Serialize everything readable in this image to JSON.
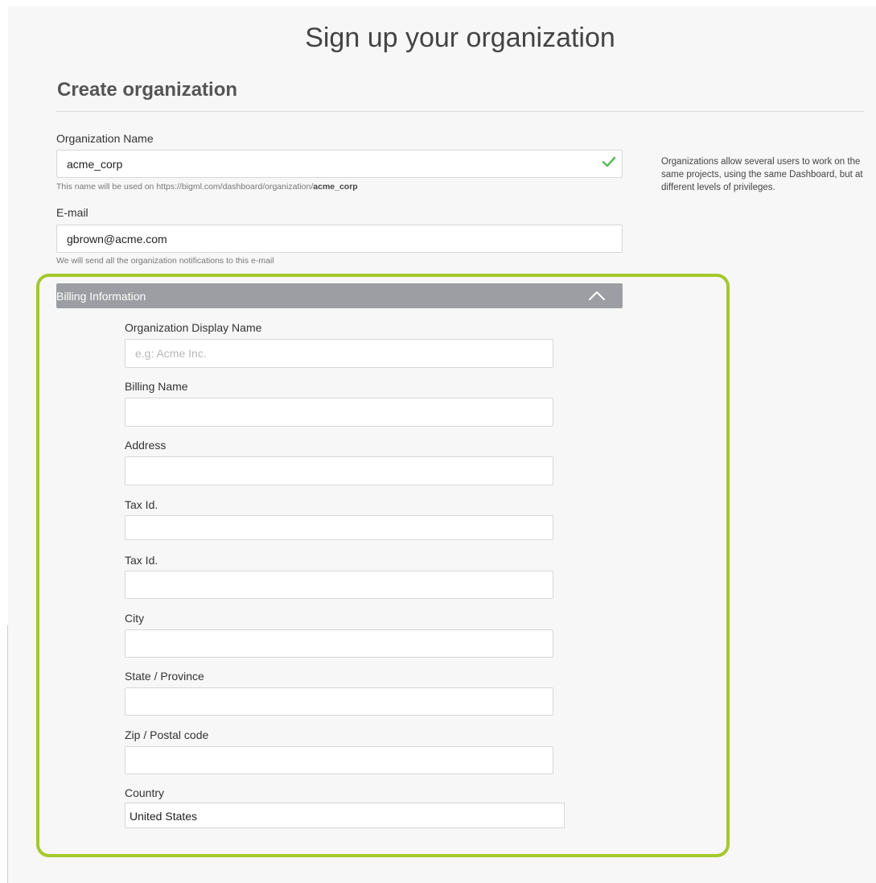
{
  "page": {
    "title": "Sign up your organization"
  },
  "section": {
    "title": "Create organization"
  },
  "org_name": {
    "label": "Organization Name",
    "value": "acme_corp",
    "hint_prefix": "This name will be used on https://bigml.com/dashboard/organization/",
    "hint_slug": "acme_corp",
    "valid_icon": "check-icon"
  },
  "email": {
    "label": "E-mail",
    "value": "gbrown@acme.com",
    "hint": "We will send all the organization notifications to this e-mail"
  },
  "side_note": "Organizations allow several users to work on the same projects, using the same Dashboard, but at different levels of privileges.",
  "billing": {
    "header": "Billing Information",
    "toggle_icon": "chevron-up-icon",
    "fields": [
      {
        "label": "Organization Display Name",
        "value": "",
        "placeholder": "e.g: Acme Inc."
      },
      {
        "label": "Billing Name",
        "value": ""
      },
      {
        "label": "Address",
        "value": ""
      },
      {
        "label": "Tax Id.",
        "value": ""
      },
      {
        "label": "Tax Id.",
        "value": ""
      },
      {
        "label": "City",
        "value": ""
      },
      {
        "label": "State / Province",
        "value": ""
      },
      {
        "label": "Zip / Postal code",
        "value": ""
      }
    ],
    "country": {
      "label": "Country",
      "selected": "United States"
    }
  },
  "colors": {
    "highlight": "#a5c82d",
    "billing_bar": "#9c9ea3",
    "check": "#5cb85c"
  }
}
